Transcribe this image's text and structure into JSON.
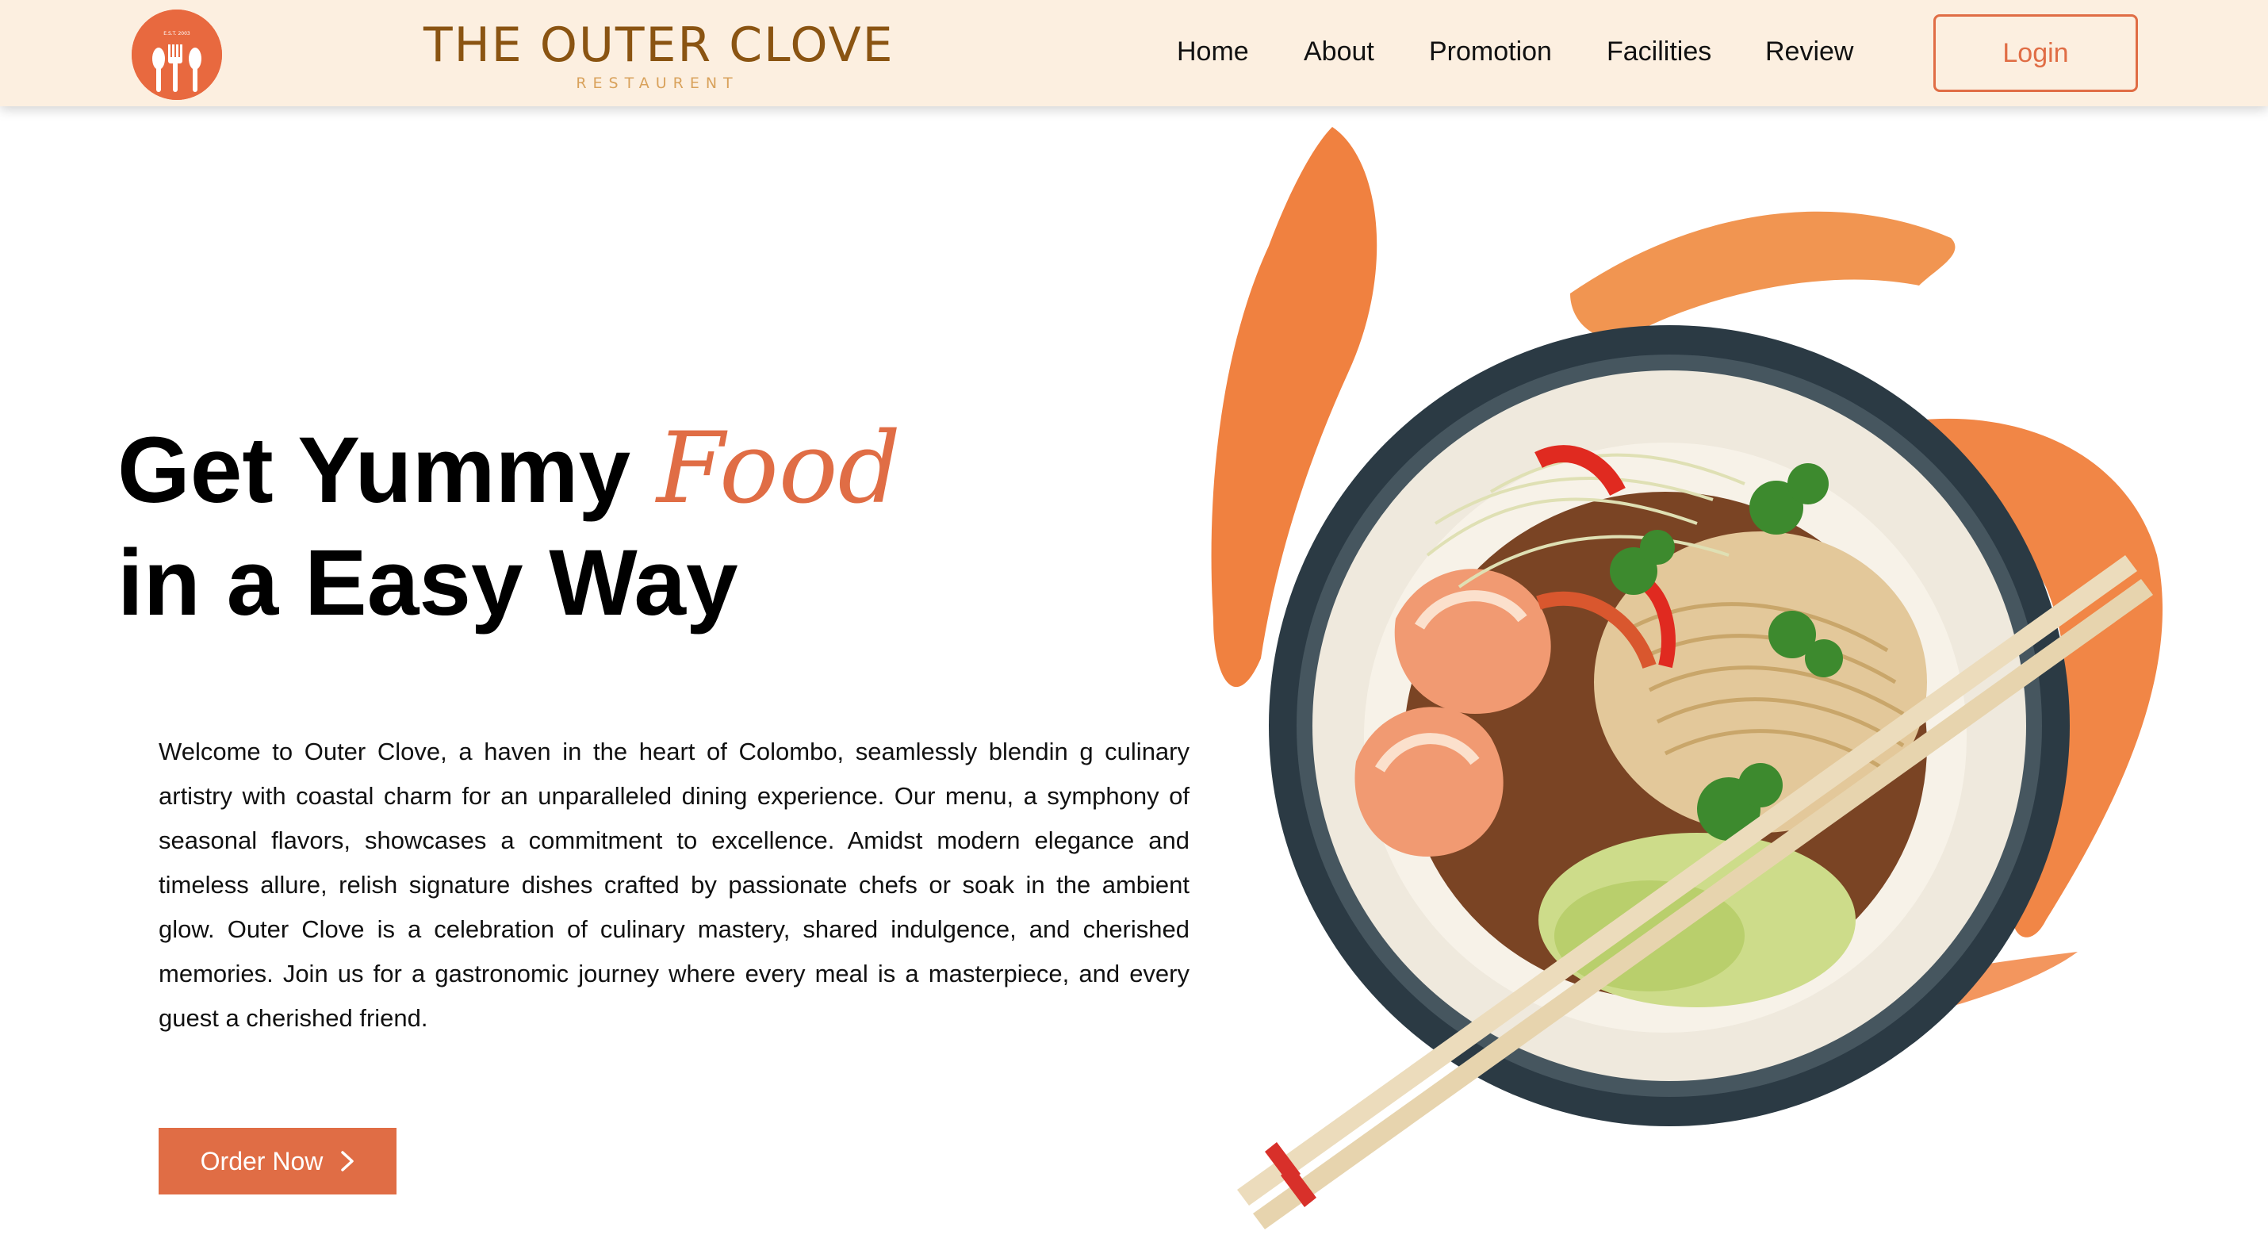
{
  "header": {
    "logo": {
      "icon": "fork-spoon-icon",
      "badge_text": "E.S.T. 2003"
    },
    "brand_title": "THE OUTER CLOVE",
    "brand_subtitle": "RESTAURENT",
    "nav": [
      {
        "label": "Home"
      },
      {
        "label": "About"
      },
      {
        "label": "Promotion"
      },
      {
        "label": "Facilities"
      },
      {
        "label": "Review"
      }
    ],
    "login_label": "Login"
  },
  "hero": {
    "title_part1": "Get Yummy",
    "title_accent": "Food",
    "title_line2": "in a Easy Way",
    "description": "Welcome to Outer Clove, a haven in the heart of Colombo, seamlessly blendin g culinary artistry with coastal charm for an unparalleled dining experience. Our menu, a symphony of seasonal flavors, showcases a commitment to excellence. Amidst modern elegance and timeless allure, relish signature dishes crafted by passionate chefs or soak in the ambient glow. Outer Clove is a celebration of culinary mastery, shared indulgence, and cherished memories. Join us for a gastronomic journey where every meal is a masterpiece, and every guest a cherished friend.",
    "order_label": "Order Now",
    "order_icon": "chevron-right-icon",
    "image_subject": "noodle-bowl-image"
  },
  "colors": {
    "header_bg": "#fcefe0",
    "accent": "#e06d45",
    "brand": "#8a5412",
    "brand_sub": "#d9a25c"
  }
}
